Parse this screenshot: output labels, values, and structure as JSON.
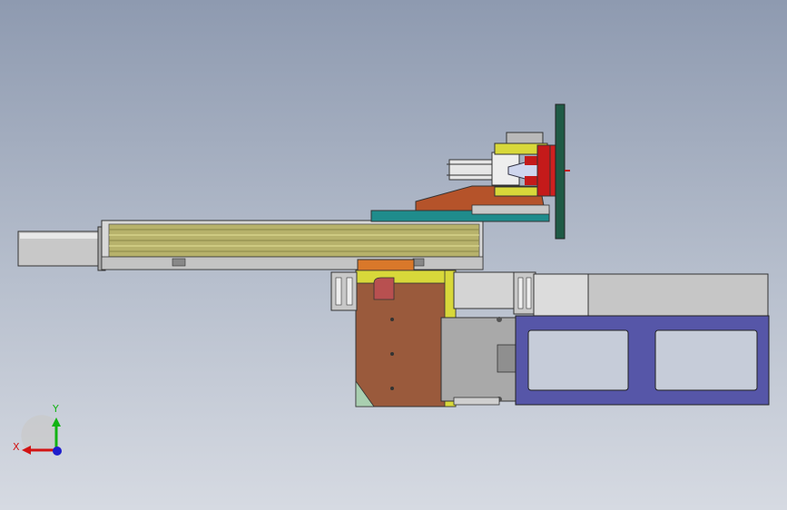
{
  "viewport": {
    "background_top": "#8e9ab0",
    "background_bottom": "#d6dae2"
  },
  "triad": {
    "x_label": "X",
    "y_label": "Y",
    "x_color": "#d21414",
    "y_color": "#12b312",
    "z_color": "#1e1ecc"
  },
  "colors": {
    "rail_body": "#b7b26b",
    "rail_dark": "#8a8547",
    "motor_gray": "#bfbfbf",
    "teal_plate": "#1f8c8c",
    "brown_block": "#9a5a3c",
    "orange_bracket": "#d9782a",
    "yellow_frame": "#d8d83a",
    "red_gripper": "#c41a1a",
    "blue_base": "#5656a8",
    "dark_green": "#1f5a45",
    "light_gray_box": "#cfcfcf"
  }
}
